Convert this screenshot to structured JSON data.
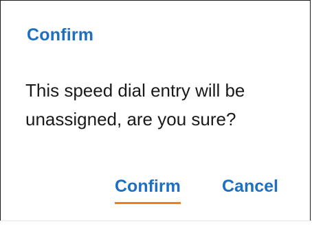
{
  "dialog": {
    "title": "Confirm",
    "message": "This speed dial entry will be unassigned, are you sure?",
    "actions": {
      "confirm_label": "Confirm",
      "cancel_label": "Cancel"
    }
  },
  "colors": {
    "accent": "#1f6fc0",
    "focus_underline": "#f07c1a",
    "text": "#1a1a1a",
    "background": "#ffffff"
  }
}
